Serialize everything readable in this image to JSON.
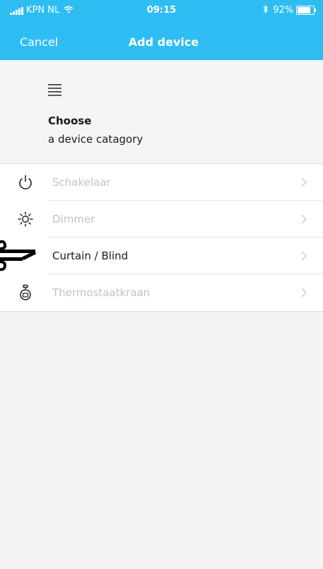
{
  "status_bar": {
    "carrier": "KPN NL",
    "time": "09:15",
    "battery": "92%",
    "battery_level": 0.92
  },
  "nav": {
    "cancel_label": "Cancel",
    "title": "Add device"
  },
  "header": {
    "title": "Choose",
    "subtitle": "a device catagory"
  },
  "categories": [
    {
      "label": "Schakelaar",
      "icon": "power-icon",
      "enabled": false
    },
    {
      "label": "Dimmer",
      "icon": "sun-icon",
      "enabled": false
    },
    {
      "label": "Curtain / Blind",
      "icon": "curtain-icon",
      "enabled": true
    },
    {
      "label": "Thermostaatkraan",
      "icon": "thermostat-valve-icon",
      "enabled": false
    }
  ],
  "colors": {
    "accent": "#2ebdf2",
    "background": "#f3f3f3",
    "disabled_text": "#c3c3c3",
    "text": "#1a1a1a"
  }
}
